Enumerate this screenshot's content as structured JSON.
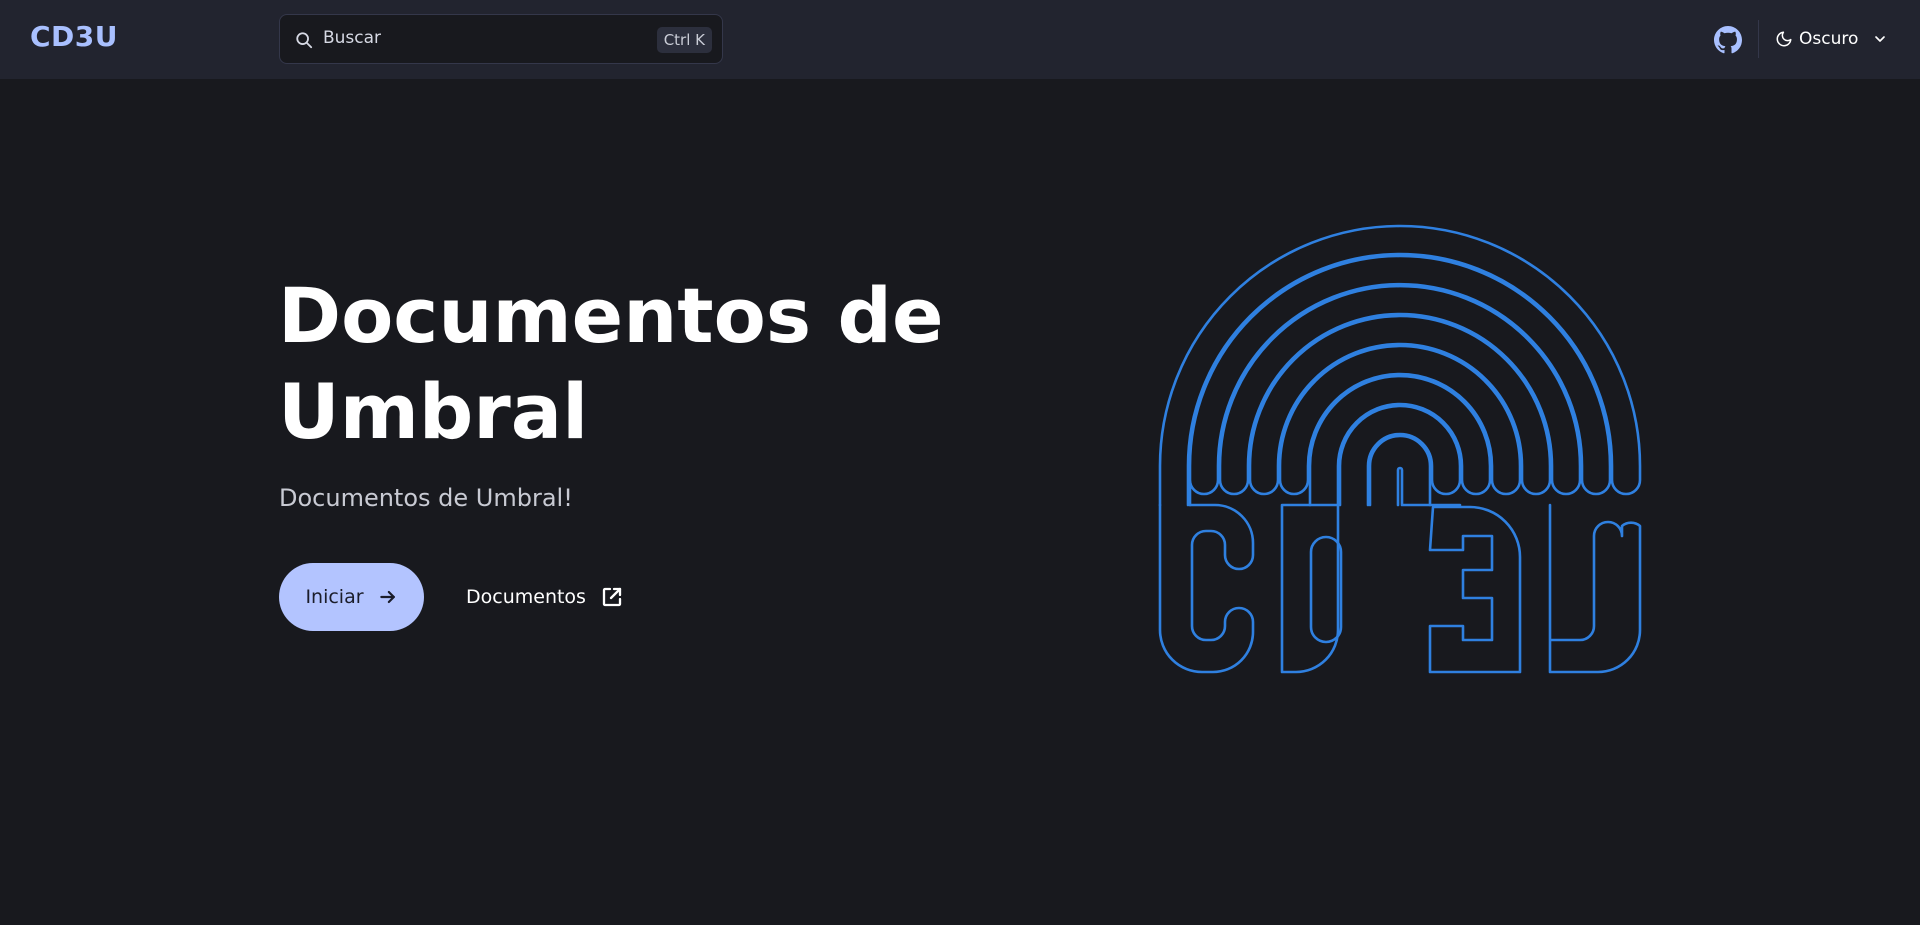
{
  "header": {
    "brand": "CD3U",
    "search": {
      "placeholder": "Buscar",
      "shortcut": "Ctrl K",
      "icon": "search-icon"
    },
    "github_icon": "github-icon",
    "theme": {
      "label": "Oscuro",
      "icon": "moon-icon",
      "chevron": "chevron-down-icon"
    }
  },
  "hero": {
    "title": "Documentos de Umbral",
    "subtitle": "Documentos de Umbral!",
    "primary_button": {
      "label": "Iniciar",
      "icon": "arrow-right-icon"
    },
    "secondary_button": {
      "label": "Documentos",
      "icon": "external-link-icon"
    },
    "logo": "CD3U"
  },
  "colors": {
    "background": "#18191e",
    "navbar": "#22242f",
    "brand": "#a9c0ff",
    "primary_button": "#b3c4ff",
    "logo_stroke": "#2f80e0"
  }
}
